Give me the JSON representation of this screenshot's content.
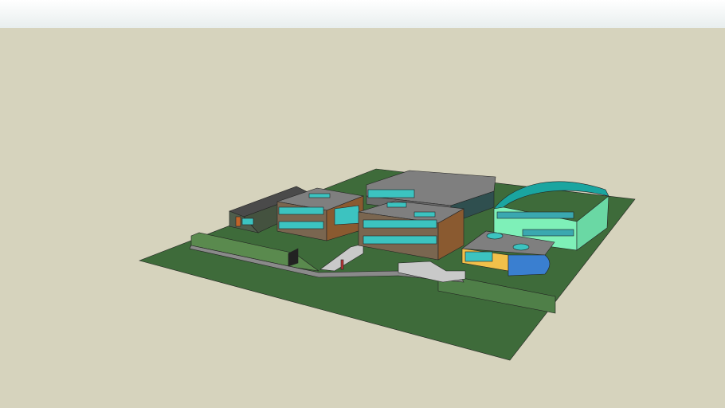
{
  "scene": {
    "colors": {
      "background": "#d6d3bd",
      "sky": "#eef2f2",
      "grass": "#3e6b3a",
      "grass_light": "#5a8a4e",
      "roof": "#7f7f7f",
      "brick": "#8a5a30",
      "glass": "#3cc3c0",
      "hall_wall": "#7ef0b8",
      "hall_roof": "#1aa5a0",
      "yellow": "#f2c04a",
      "blue": "#3a7fd0",
      "path": "#9a9a9a"
    }
  }
}
